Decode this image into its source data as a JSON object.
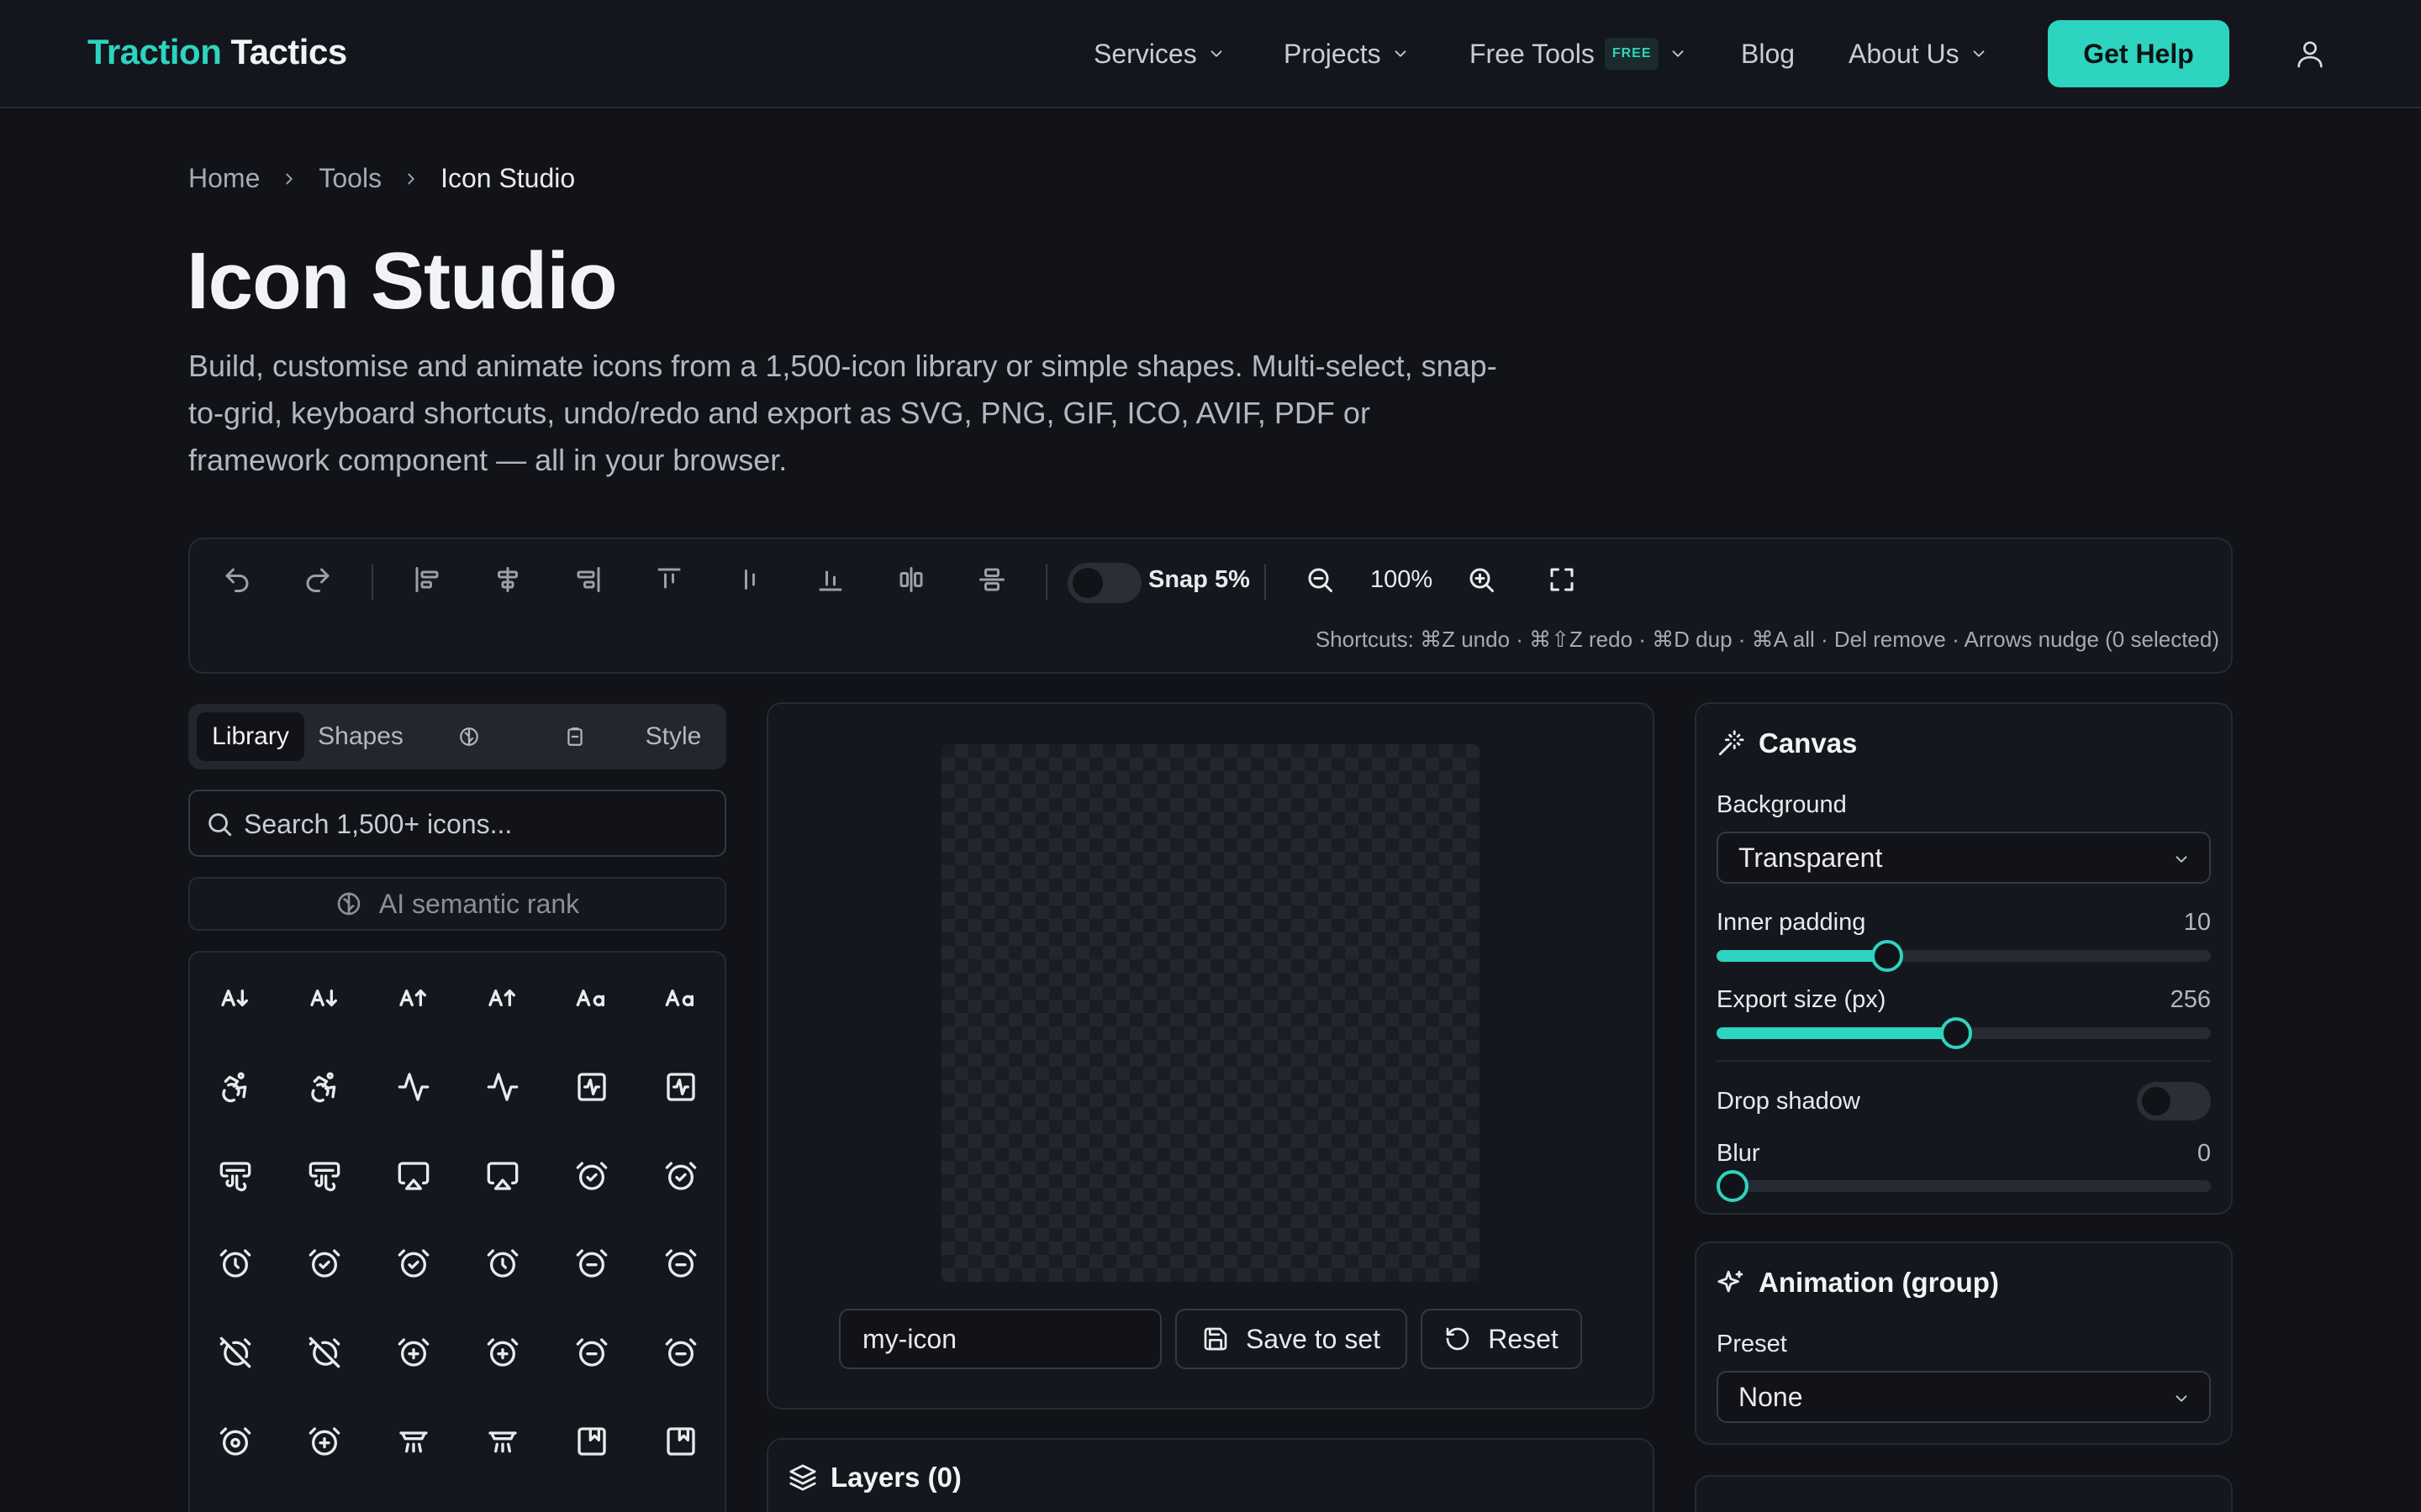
{
  "brand": {
    "part1": "Traction",
    "part2": "Tactics"
  },
  "nav": {
    "services": "Services",
    "projects": "Projects",
    "free_tools": "Free Tools",
    "free_badge": "FREE",
    "blog": "Blog",
    "about": "About Us",
    "cta": "Get Help"
  },
  "breadcrumb": {
    "home": "Home",
    "tools": "Tools",
    "current": "Icon Studio"
  },
  "page": {
    "title": "Icon Studio",
    "description": "Build, customise and animate icons from a 1,500-icon library or simple shapes. Multi-select, snap-to-grid, keyboard shortcuts, undo/redo and export as SVG, PNG, GIF, ICO, AVIF, PDF or framework component — all in your browser."
  },
  "toolbar": {
    "snap_label": "Snap 5%",
    "zoom": "100%",
    "shortcuts": "Shortcuts: ⌘Z undo · ⌘⇧Z redo · ⌘D dup · ⌘A all · Del remove · Arrows nudge (0 selected)"
  },
  "left_panel": {
    "tabs": {
      "library": "Library",
      "shapes": "Shapes",
      "style": "Style"
    },
    "search_placeholder": "Search 1,500+ icons...",
    "ai_rank": "AI semantic rank"
  },
  "canvas": {
    "name_value": "my-icon",
    "save_label": "Save to set",
    "reset_label": "Reset"
  },
  "layers": {
    "title": "Layers (0)"
  },
  "canvas_settings": {
    "title": "Canvas",
    "background_label": "Background",
    "background_value": "Transparent",
    "inner_padding_label": "Inner padding",
    "inner_padding_value": "10",
    "inner_padding_fraction": 0.345,
    "export_size_label": "Export size (px)",
    "export_size_value": "256",
    "export_size_fraction": 0.485,
    "drop_shadow_label": "Drop shadow",
    "blur_label": "Blur",
    "blur_value": "0",
    "blur_fraction": 0.0
  },
  "animation": {
    "title": "Animation (group)",
    "preset_label": "Preset",
    "preset_value": "None"
  },
  "colors": {
    "accent": "#2dd4bf",
    "background": "#111318"
  }
}
